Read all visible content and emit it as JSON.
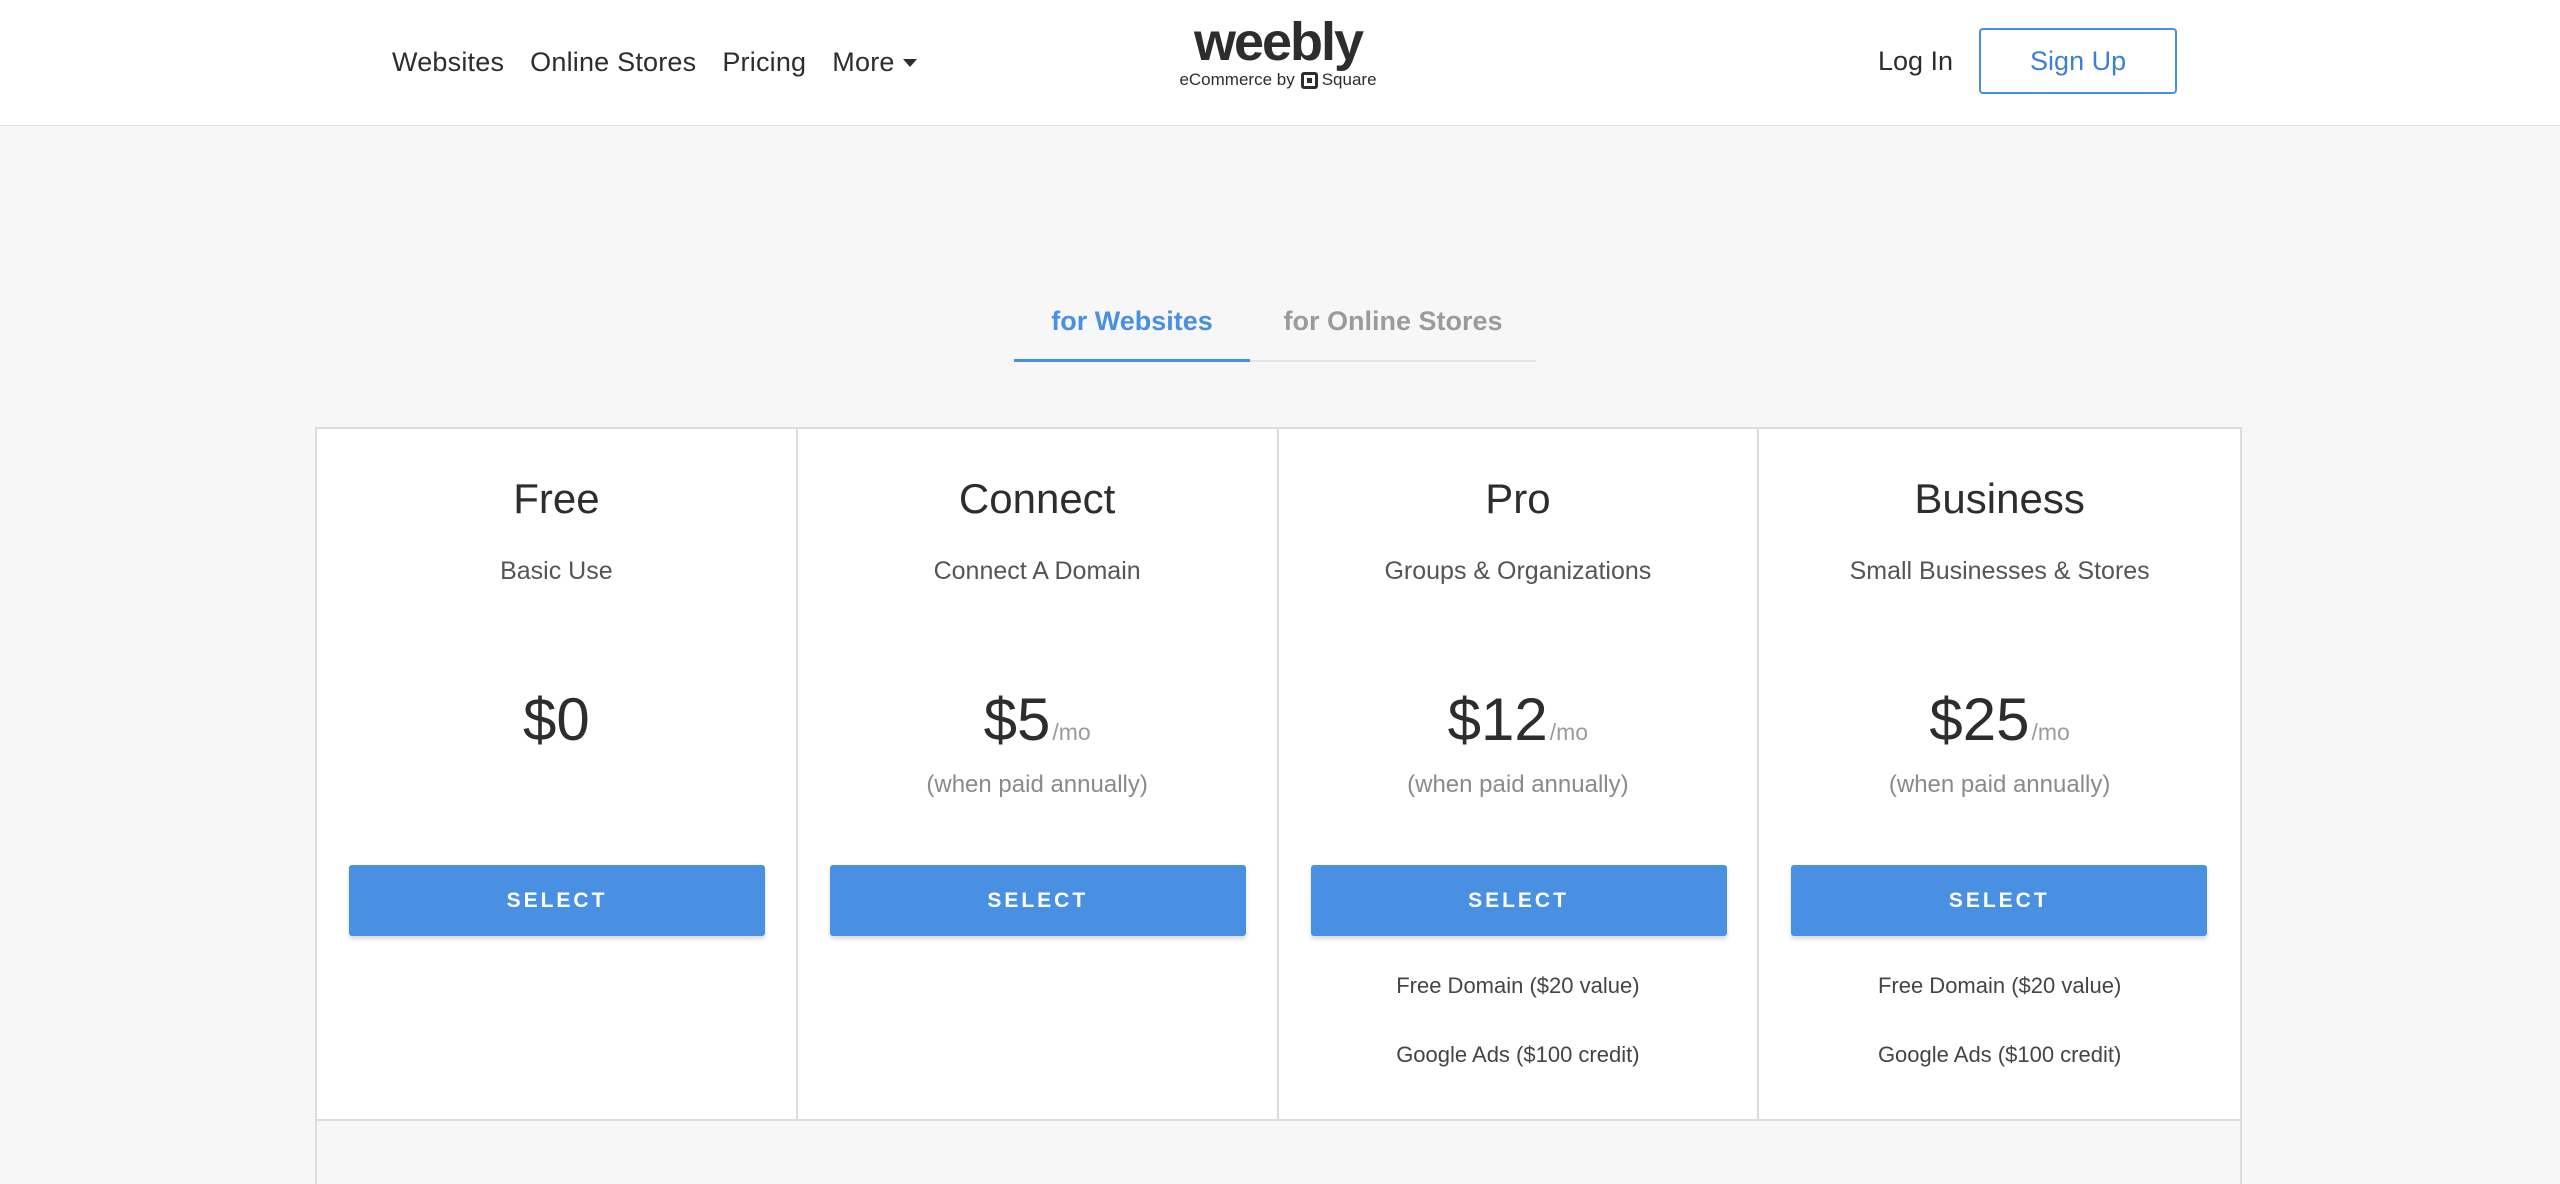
{
  "header": {
    "nav": [
      "Websites",
      "Online Stores",
      "Pricing"
    ],
    "more_label": "More",
    "logo_word": "weebly",
    "logo_sub_prefix": "eCommerce by",
    "logo_sub_brand": "Square",
    "login_label": "Log In",
    "signup_label": "Sign Up"
  },
  "tabs": [
    {
      "label": "for Websites",
      "active": true
    },
    {
      "label": "for Online Stores",
      "active": false
    }
  ],
  "plans": [
    {
      "name": "Free",
      "desc": "Basic Use",
      "price": "$0",
      "per": "",
      "note": "",
      "button": "SELECT",
      "features": []
    },
    {
      "name": "Connect",
      "desc": "Connect A Domain",
      "price": "$5",
      "per": "/mo",
      "note": "(when paid annually)",
      "button": "SELECT",
      "features": []
    },
    {
      "name": "Pro",
      "desc": "Groups & Organizations",
      "price": "$12",
      "per": "/mo",
      "note": "(when paid annually)",
      "button": "SELECT",
      "features": [
        "Free Domain ($20 value)",
        "Google Ads ($100 credit)"
      ]
    },
    {
      "name": "Business",
      "desc": "Small Businesses & Stores",
      "price": "$25",
      "per": "/mo",
      "note": "(when paid annually)",
      "button": "SELECT",
      "features": [
        "Free Domain ($20 value)",
        "Google Ads ($100 credit)"
      ]
    }
  ],
  "colors": {
    "accent": "#4a90e2",
    "text": "#2d2d2d",
    "muted": "#9b9b9b"
  }
}
